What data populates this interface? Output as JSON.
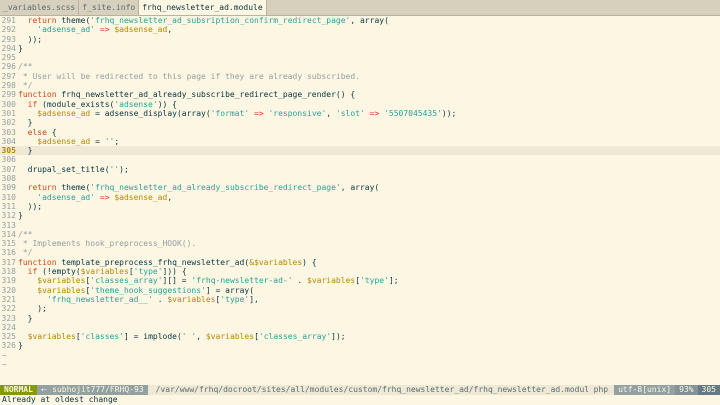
{
  "tabs": [
    {
      "label": "_variables.scss",
      "active": false
    },
    {
      "label": "f_site.info",
      "active": false
    },
    {
      "label": "frhq_newsletter_ad.module",
      "active": true
    }
  ],
  "colors": {
    "keyword": "#cb4b16",
    "function": "#268bd2",
    "string": "#2aa198",
    "variable": "#b58900",
    "comment": "#93a1a1",
    "plain": "#073642",
    "operator": "#dc322f"
  },
  "lines": [
    {
      "n": "291",
      "t": [
        [
          "  ",
          "p"
        ],
        [
          "return",
          "k"
        ],
        [
          " theme(",
          "p"
        ],
        [
          "'frhq_newsletter_ad_subsription_confirm_redirect_page'",
          "s"
        ],
        [
          ", array(",
          "p"
        ]
      ]
    },
    {
      "n": "292",
      "t": [
        [
          "    ",
          "p"
        ],
        [
          "'adsense_ad'",
          "s"
        ],
        [
          " => ",
          "o"
        ],
        [
          "$adsense_ad",
          "v"
        ],
        [
          ",",
          "p"
        ]
      ]
    },
    {
      "n": "293",
      "t": [
        [
          "  ));",
          "p"
        ]
      ]
    },
    {
      "n": "294",
      "t": [
        [
          "}",
          "p"
        ]
      ]
    },
    {
      "n": "295",
      "t": [
        [
          "",
          "p"
        ]
      ]
    },
    {
      "n": "296",
      "t": [
        [
          "/**",
          "c"
        ]
      ]
    },
    {
      "n": "297",
      "t": [
        [
          " * User will be redirected to this page if they are already subscribed.",
          "c"
        ]
      ]
    },
    {
      "n": "298",
      "t": [
        [
          " */",
          "c"
        ]
      ]
    },
    {
      "n": "299",
      "t": [
        [
          "function",
          "k"
        ],
        [
          " frhq_newsletter_ad_already_subscribe_redirect_page_render() {",
          "p"
        ]
      ]
    },
    {
      "n": "300",
      "t": [
        [
          "  ",
          "p"
        ],
        [
          "if",
          "k"
        ],
        [
          " (module_exists(",
          "p"
        ],
        [
          "'adsense'",
          "s"
        ],
        [
          ")) {",
          "p"
        ]
      ]
    },
    {
      "n": "301",
      "t": [
        [
          "    ",
          "p"
        ],
        [
          "$adsense_ad",
          "v"
        ],
        [
          " = adsense_display(array(",
          "p"
        ],
        [
          "'format'",
          "s"
        ],
        [
          " => ",
          "o"
        ],
        [
          "'responsive'",
          "s"
        ],
        [
          ", ",
          "p"
        ],
        [
          "'slot'",
          "s"
        ],
        [
          " => ",
          "o"
        ],
        [
          "'5507045435'",
          "s"
        ],
        [
          "));",
          "p"
        ]
      ]
    },
    {
      "n": "302",
      "t": [
        [
          "  }",
          "p"
        ]
      ]
    },
    {
      "n": "303",
      "t": [
        [
          "  ",
          "p"
        ],
        [
          "else",
          "k"
        ],
        [
          " {",
          "p"
        ]
      ]
    },
    {
      "n": "304",
      "t": [
        [
          "    ",
          "p"
        ],
        [
          "$adsense_ad",
          "v"
        ],
        [
          " = ",
          "p"
        ],
        [
          "''",
          "s"
        ],
        [
          ";",
          "p"
        ]
      ]
    },
    {
      "n": "305",
      "t": [
        [
          "  }",
          "p"
        ]
      ],
      "current": true
    },
    {
      "n": "306",
      "t": [
        [
          "",
          "p"
        ]
      ]
    },
    {
      "n": "307",
      "t": [
        [
          "  drupal_set_title(",
          "p"
        ],
        [
          "''",
          "s"
        ],
        [
          ");",
          "p"
        ]
      ]
    },
    {
      "n": "308",
      "t": [
        [
          "",
          "p"
        ]
      ]
    },
    {
      "n": "309",
      "t": [
        [
          "  ",
          "p"
        ],
        [
          "return",
          "k"
        ],
        [
          " theme(",
          "p"
        ],
        [
          "'frhq_newsletter_ad_already_subscribe_redirect_page'",
          "s"
        ],
        [
          ", array(",
          "p"
        ]
      ]
    },
    {
      "n": "310",
      "t": [
        [
          "    ",
          "p"
        ],
        [
          "'adsense_ad'",
          "s"
        ],
        [
          " => ",
          "o"
        ],
        [
          "$adsense_ad",
          "v"
        ],
        [
          ",",
          "p"
        ]
      ]
    },
    {
      "n": "311",
      "t": [
        [
          "  ));",
          "p"
        ]
      ]
    },
    {
      "n": "312",
      "t": [
        [
          "}",
          "p"
        ]
      ]
    },
    {
      "n": "313",
      "t": [
        [
          "",
          "p"
        ]
      ]
    },
    {
      "n": "314",
      "t": [
        [
          "/**",
          "c"
        ]
      ]
    },
    {
      "n": "315",
      "t": [
        [
          " * Implements hook_preprocess_HOOK().",
          "c"
        ]
      ]
    },
    {
      "n": "316",
      "t": [
        [
          " */",
          "c"
        ]
      ]
    },
    {
      "n": "317",
      "t": [
        [
          "function",
          "k"
        ],
        [
          " template_preprocess_frhq_newsletter_ad(",
          "p"
        ],
        [
          "&$variables",
          "v"
        ],
        [
          ") {",
          "p"
        ]
      ]
    },
    {
      "n": "318",
      "t": [
        [
          "  ",
          "p"
        ],
        [
          "if",
          "k"
        ],
        [
          " (!empty(",
          "p"
        ],
        [
          "$variables",
          "v"
        ],
        [
          "[",
          "p"
        ],
        [
          "'type'",
          "s"
        ],
        [
          "])) {",
          "p"
        ]
      ]
    },
    {
      "n": "319",
      "t": [
        [
          "    ",
          "p"
        ],
        [
          "$variables",
          "v"
        ],
        [
          "[",
          "p"
        ],
        [
          "'classes_array'",
          "s"
        ],
        [
          "][] = ",
          "p"
        ],
        [
          "'frhq-newsletter-ad-'",
          "s"
        ],
        [
          " . ",
          "p"
        ],
        [
          "$variables",
          "v"
        ],
        [
          "[",
          "p"
        ],
        [
          "'type'",
          "s"
        ],
        [
          "];",
          "p"
        ]
      ]
    },
    {
      "n": "320",
      "t": [
        [
          "    ",
          "p"
        ],
        [
          "$variables",
          "v"
        ],
        [
          "[",
          "p"
        ],
        [
          "'theme_hook_suggestions'",
          "s"
        ],
        [
          "] = array(",
          "p"
        ]
      ]
    },
    {
      "n": "321",
      "t": [
        [
          "      ",
          "p"
        ],
        [
          "'frhq_newsletter_ad__'",
          "s"
        ],
        [
          " . ",
          "p"
        ],
        [
          "$variables",
          "v"
        ],
        [
          "[",
          "p"
        ],
        [
          "'type'",
          "s"
        ],
        [
          "],",
          "p"
        ]
      ]
    },
    {
      "n": "322",
      "t": [
        [
          "    );",
          "p"
        ]
      ]
    },
    {
      "n": "323",
      "t": [
        [
          "  }",
          "p"
        ]
      ]
    },
    {
      "n": "324",
      "t": [
        [
          "",
          "p"
        ]
      ]
    },
    {
      "n": "325",
      "t": [
        [
          "  ",
          "p"
        ],
        [
          "$variables",
          "v"
        ],
        [
          "[",
          "p"
        ],
        [
          "'classes'",
          "s"
        ],
        [
          "] = implode(",
          "p"
        ],
        [
          "' '",
          "s"
        ],
        [
          ", ",
          "p"
        ],
        [
          "$variables",
          "v"
        ],
        [
          "[",
          "p"
        ],
        [
          "'classes_array'",
          "s"
        ],
        [
          "]);",
          "p"
        ]
      ]
    },
    {
      "n": "326",
      "t": [
        [
          "}",
          "p"
        ]
      ]
    }
  ],
  "tilde_count": 2,
  "status": {
    "mode": "NORMAL",
    "branch": "⭠ subhojit777/FRHQ-93",
    "path": "/var/www/frhq/docroot/sites/all/modules/custom/frhq_newsletter_ad/frhq_newsletter_ad.module",
    "filetype": "php",
    "encoding": "utf-8[unix]",
    "percent": "93%",
    "position": "305"
  },
  "message": "Already at oldest change"
}
